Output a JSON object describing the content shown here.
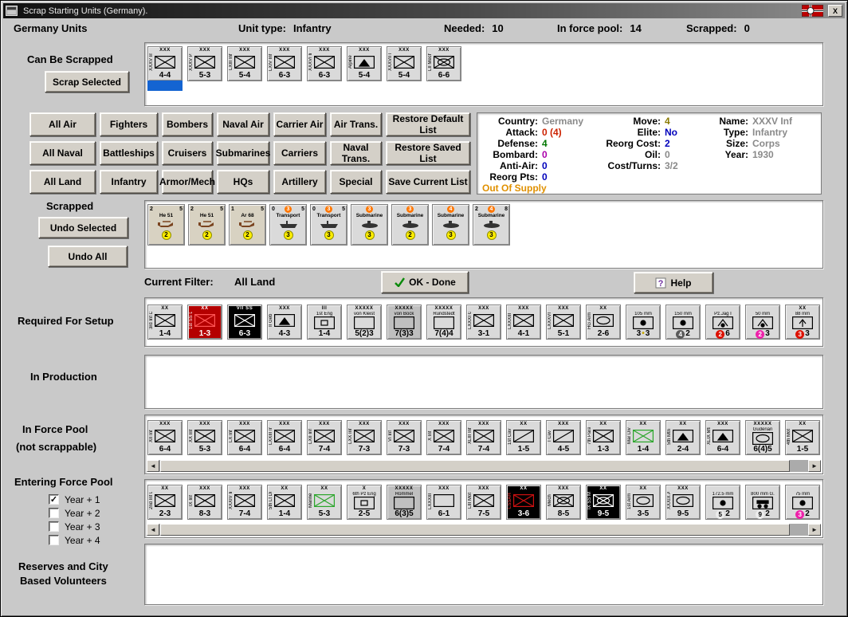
{
  "window": {
    "title": "Scrap Starting Units (Germany).",
    "close_label": "X"
  },
  "glyphs": {
    "arrow_left": "◄",
    "arrow_right": "►",
    "check": "✓"
  },
  "header": {
    "title": "Germany Units",
    "unit_type_label": "Unit type:",
    "unit_type_value": "Infantry",
    "needed_label": "Needed:",
    "needed_value": "10",
    "pool_label": "In force pool:",
    "pool_value": "14",
    "scrapped_label": "Scrapped:",
    "scrapped_value": "0"
  },
  "sections": {
    "can_be_scrapped_label": "Can Be Scrapped",
    "scrap_selected_button": "Scrap Selected",
    "scrapped_label": "Scrapped",
    "undo_selected_button": "Undo Selected",
    "undo_all_button": "Undo All",
    "current_filter_label": "Current Filter:",
    "current_filter_value": "All Land",
    "ok_done_button": "OK - Done",
    "help_button": "Help",
    "required_label": "Required For Setup",
    "in_production_label": "In Production",
    "force_pool_label1": "In Force Pool",
    "force_pool_label2": "(not scrappable)",
    "entering_label": "Entering Force Pool",
    "reserves_label1": "Reserves and City",
    "reserves_label2": "Based Volunteers"
  },
  "filter_buttons": [
    [
      "All Air",
      "Fighters",
      "Bombers",
      "Naval Air",
      "Carrier Air",
      "Air Trans.",
      "Restore Default List"
    ],
    [
      "All Naval",
      "Battleships",
      "Cruisers",
      "Submarines",
      "Carriers",
      "Naval Trans.",
      "Restore Saved List"
    ],
    [
      "All Land",
      "Infantry",
      "Armor/Mech",
      "HQs",
      "Artillery",
      "Special",
      "Save Current List"
    ]
  ],
  "info_panel": {
    "columns": [
      {
        "rows": [
          {
            "label": "Country:",
            "value": "Germany",
            "color": "#8a8a8a"
          },
          {
            "label": "Attack:",
            "value": "0 (4)",
            "color": "#cc2200"
          },
          {
            "label": "Defense:",
            "value": "4",
            "color": "#007700"
          },
          {
            "label": "Bombard:",
            "value": "0",
            "color": "#aa00aa"
          },
          {
            "label": "Anti-Air:",
            "value": "0",
            "color": "#0000bb"
          },
          {
            "label": "Reorg Pts:",
            "value": "0",
            "color": "#0000bb"
          },
          {
            "label": "",
            "value": "Out Of Supply",
            "color": "#e09000"
          }
        ]
      },
      {
        "rows": [
          {
            "label": "Move:",
            "value": "4",
            "color": "#8a7a00"
          },
          {
            "label": "Elite:",
            "value": "No",
            "color": "#0000bb"
          },
          {
            "label": "Reorg Cost:",
            "value": "2",
            "color": "#0000bb"
          },
          {
            "label": "Oil:",
            "value": "0",
            "color": "#8a8a8a"
          },
          {
            "label": "Cost/Turns:",
            "value": "3/2",
            "color": "#8a8a8a"
          }
        ]
      },
      {
        "rows": [
          {
            "label": "Name:",
            "value": "XXXV Inf",
            "color": "#8a8a8a"
          },
          {
            "label": "Type:",
            "value": "Infantry",
            "color": "#8a8a8a"
          },
          {
            "label": "Size:",
            "value": "Corps",
            "color": "#8a8a8a"
          },
          {
            "label": "Year:",
            "value": "1930",
            "color": "#8a8a8a"
          }
        ]
      }
    ]
  },
  "year_filters": [
    {
      "label": "Year + 1",
      "checked": true
    },
    {
      "label": "Year + 2",
      "checked": false
    },
    {
      "label": "Year + 3",
      "checked": false
    },
    {
      "label": "Year + 4",
      "checked": false
    }
  ],
  "counters": {
    "can_be_scrapped": [
      {
        "top": "XXX",
        "side": "XXXV Inf",
        "sym": "inf",
        "stats": "4-4",
        "sel": true
      },
      {
        "top": "XXX",
        "side": "XXXV Pz",
        "sym": "inf",
        "stats": "5-3"
      },
      {
        "top": "XXX",
        "side": "LXIII Inf",
        "sym": "inf",
        "stats": "5-4"
      },
      {
        "top": "XXX",
        "side": "LXIV Inf",
        "sym": "inf",
        "stats": "6-3"
      },
      {
        "top": "XXX",
        "side": "XXXVI Inf",
        "sym": "inf",
        "stats": "6-3"
      },
      {
        "top": "XXX",
        "side": "Alpine",
        "sym": "mtn",
        "stats": "5-4"
      },
      {
        "top": "XXX",
        "side": "XXXVII M.",
        "sym": "inf",
        "stats": "5-4"
      },
      {
        "top": "XXX",
        "side": "LII Mech",
        "sym": "mech",
        "stats": "6-6"
      }
    ],
    "scrapped": [
      {
        "nums": [
          {
            "t": "2"
          },
          {
            "t": ""
          },
          {
            "t": "5"
          }
        ],
        "name": "He 51",
        "icon": "plane",
        "badge": "2",
        "bg": "#d8d2c2"
      },
      {
        "nums": [
          {
            "t": "2"
          },
          {
            "t": ""
          },
          {
            "t": "5"
          }
        ],
        "name": "He 51",
        "icon": "plane",
        "badge": "2",
        "bg": "#d8d2c2"
      },
      {
        "nums": [
          {
            "t": "1"
          },
          {
            "t": ""
          },
          {
            "t": "5"
          }
        ],
        "name": "Ar 68",
        "icon": "plane",
        "badge": "2",
        "bg": "#d8d2c2"
      },
      {
        "nums": [
          {
            "t": "0"
          },
          {
            "t": "3",
            "bg": "#ff7700",
            "fg": "#ffffff"
          },
          {
            "t": "5"
          }
        ],
        "name": "Transport",
        "icon": "ship",
        "badge": "3"
      },
      {
        "nums": [
          {
            "t": "0"
          },
          {
            "t": "3",
            "bg": "#ff7700",
            "fg": "#ffffff"
          },
          {
            "t": "5"
          }
        ],
        "name": "Transport",
        "icon": "ship",
        "badge": "3"
      },
      {
        "nums": [
          {
            "t": "3",
            "bg": "#ff7700",
            "fg": "#ffffff"
          }
        ],
        "name": "Submarine",
        "icon": "sub",
        "badge": "3"
      },
      {
        "nums": [
          {
            "t": "3",
            "bg": "#ff7700",
            "fg": "#ffffff"
          }
        ],
        "name": "Submarine",
        "icon": "sub",
        "badge": "2"
      },
      {
        "nums": [
          {
            "t": "4",
            "bg": "#ff7700",
            "fg": "#ffffff"
          }
        ],
        "name": "Submarine",
        "icon": "sub",
        "badge": "3"
      },
      {
        "nums": [
          {
            "t": "2"
          },
          {
            "t": "4",
            "bg": "#ff7700",
            "fg": "#ffffff"
          },
          {
            "t": "8"
          }
        ],
        "name": "Submarine",
        "icon": "sub",
        "badge": "3"
      }
    ],
    "required": [
      {
        "top": "XX",
        "side": "3rd Inf Div",
        "sym": "inf",
        "stats": "1-4"
      },
      {
        "top": "XX",
        "side": "1st SS Div",
        "sym": "inf",
        "stats": "1-3",
        "bg": "#b40000",
        "fg": "#ffffff",
        "symc": "#ff5555"
      },
      {
        "top": "VII SS",
        "side": "",
        "sym": "inf",
        "stats": "6-3",
        "bg": "#000000",
        "fg": "#ffffff",
        "symc": "#ffffff"
      },
      {
        "top": "XXX",
        "side": "II Geb",
        "sym": "mtn",
        "stats": "4-3"
      },
      {
        "top": "III",
        "side": "1st Eng",
        "sym": "eng",
        "stats": "1-4",
        "h": true
      },
      {
        "top": "XXXXX",
        "side": "von Kleist",
        "sym": "hq",
        "stats": "5(2)3",
        "h": true
      },
      {
        "top": "XXXXX",
        "side": "von Bock",
        "sym": "hq",
        "stats": "7(3)3",
        "h": true,
        "bg": "#bfbfbf"
      },
      {
        "top": "XXXXX",
        "side": "Rundstedt",
        "sym": "hq",
        "stats": "7(4)4",
        "h": true
      },
      {
        "top": "XXX",
        "side": "LXXXI Ga.",
        "sym": "inf",
        "stats": "3-1"
      },
      {
        "top": "XXX",
        "side": "LXXXIII Ga.",
        "sym": "inf",
        "stats": "4-1"
      },
      {
        "top": "XXX",
        "side": "LXXXVI Ga.",
        "sym": "inf",
        "stats": "5-1"
      },
      {
        "top": "XX",
        "side": "HG Arm Div",
        "sym": "armor",
        "stats": "2-6"
      },
      {
        "top": "",
        "side": "105 mm",
        "sym": "art",
        "h": true,
        "stats": [
          {
            "t": "3"
          },
          {
            "t": "•",
            "fg": "#c8a800"
          },
          {
            "t": "3"
          }
        ]
      },
      {
        "top": "",
        "side": "150 mm",
        "sym": "art",
        "h": true,
        "stats": [
          {
            "t": "4",
            "bg": "#5a5a5a",
            "fg": "#ffffff"
          },
          {
            "t": "2"
          }
        ]
      },
      {
        "top": "",
        "side": "Pz.Jag I",
        "sym": "at",
        "h": true,
        "stats": [
          {
            "t": "2",
            "bg": "#dd1100",
            "fg": "#ffffff"
          },
          {
            "t": "6"
          }
        ]
      },
      {
        "top": "",
        "side": "50 mm",
        "sym": "at",
        "h": true,
        "stats": [
          {
            "t": "2",
            "bg": "#ee22aa",
            "fg": "#ffffff"
          },
          {
            "t": "3"
          }
        ]
      },
      {
        "top": "XX",
        "side": "88 mm",
        "sym": "flak",
        "h": true,
        "stats": [
          {
            "t": "3",
            "bg": "#dd1100",
            "fg": "#ffffff"
          },
          {
            "t": "3"
          }
        ]
      }
    ],
    "in_force_pool": [
      {
        "top": "XXX",
        "side": "XII Inf",
        "sym": "inf",
        "stats": "6-4"
      },
      {
        "top": "XXX",
        "side": "XX Inf",
        "sym": "inf",
        "stats": "5-3"
      },
      {
        "top": "XXX",
        "side": "LX Inf",
        "sym": "inf",
        "stats": "6-4"
      },
      {
        "top": "XXX",
        "side": "LXXIII Inf",
        "sym": "inf",
        "stats": "6-4"
      },
      {
        "top": "XXX",
        "side": "LXII Inf",
        "sym": "inf",
        "stats": "7-4"
      },
      {
        "top": "XXX",
        "side": "LXX Inf",
        "sym": "inf",
        "stats": "7-3"
      },
      {
        "top": "XXX",
        "side": "VI Inf",
        "sym": "inf",
        "stats": "7-3"
      },
      {
        "top": "XXX",
        "side": "X Inf",
        "sym": "inf",
        "stats": "7-4"
      },
      {
        "top": "XXX",
        "side": "XLIII Inf",
        "sym": "inf",
        "stats": "7-4"
      },
      {
        "top": "XX",
        "side": "1st Cav Div",
        "sym": "cav",
        "stats": "1-5"
      },
      {
        "top": "XXX",
        "side": "I Cav",
        "sym": "cav",
        "stats": "4-5"
      },
      {
        "top": "XX",
        "side": "7th Para Div",
        "sym": "inf",
        "stats": "1-3"
      },
      {
        "top": "XX",
        "side": "Mar Div",
        "sym": "inf",
        "stats": "1-4",
        "symc": "#2aa52a"
      },
      {
        "top": "XX",
        "side": "5th Mtn Div",
        "sym": "mtn",
        "stats": "2-4"
      },
      {
        "top": "XXX",
        "side": "XLIX Mtn",
        "sym": "mtn",
        "stats": "6-4"
      },
      {
        "top": "XXXXX",
        "side": "Guderian",
        "sym": "hq_arm",
        "stats": "6(4)5",
        "h": true
      },
      {
        "top": "XX",
        "side": "4th Mot Div",
        "sym": "inf",
        "stats": "1-5"
      }
    ],
    "entering": [
      {
        "top": "XX",
        "side": "2nd Inf Div",
        "sym": "inf",
        "stats": "2-3"
      },
      {
        "top": "XXX",
        "side": "IX Inf",
        "sym": "inf",
        "stats": "8-3"
      },
      {
        "top": "XXX",
        "side": "XXXIV Inf",
        "sym": "inf",
        "stats": "7-4"
      },
      {
        "top": "XX",
        "side": "5th Lt Div",
        "sym": "inf",
        "stats": "1-4"
      },
      {
        "top": "XX",
        "side": "Marine",
        "sym": "inf",
        "stats": "5-3",
        "symc": "#2aa52a"
      },
      {
        "top": "X",
        "side": "6th Pz Eng",
        "sym": "eng",
        "stats": "2-5",
        "h": true
      },
      {
        "top": "XXXXX",
        "side": "Rommel",
        "sym": "hq",
        "stats": "6(3)5",
        "h": true,
        "bg": "#bfbfbf"
      },
      {
        "top": "XXX",
        "side": "LXXXIII Garr",
        "sym": "hq",
        "stats": "6-1"
      },
      {
        "top": "XXX",
        "side": "LIII Mot",
        "sym": "inf",
        "stats": "7-5"
      },
      {
        "top": "XX",
        "side": "LSSAH",
        "sym": "inf",
        "stats": "3-6",
        "bg": "#000000",
        "fg": "#ffffff",
        "symc": "#cc1111",
        "sidec": "#ff3333"
      },
      {
        "top": "XXX",
        "side": "Mech",
        "sym": "mech",
        "stats": "8-5"
      },
      {
        "top": "XX",
        "side": "IX SS Mech",
        "sym": "mech",
        "stats": "9-5",
        "bg": "#000000",
        "fg": "#ffffff",
        "symc": "#ffffff"
      },
      {
        "top": "XX",
        "side": "1st Arm Div",
        "sym": "armor",
        "stats": "3-5"
      },
      {
        "top": "XXX",
        "side": "XXXIX Arm",
        "sym": "armor",
        "stats": "9-5"
      },
      {
        "top": "",
        "side": "172.5 mm",
        "sym": "art",
        "h": true,
        "stats": [
          {
            "t": "5",
            "bg": "#ececec"
          },
          {
            "t": "2"
          }
        ]
      },
      {
        "top": "",
        "side": "800 mm G.",
        "sym": "rail",
        "h": true,
        "stats": [
          {
            "t": "9",
            "bg": "#ececec"
          },
          {
            "t": "2"
          }
        ]
      },
      {
        "top": "",
        "side": "75 mm",
        "sym": "art",
        "h": true,
        "stats": [
          {
            "t": "3",
            "bg": "#ee22aa",
            "fg": "#ffffff"
          },
          {
            "t": "2"
          }
        ]
      }
    ]
  }
}
